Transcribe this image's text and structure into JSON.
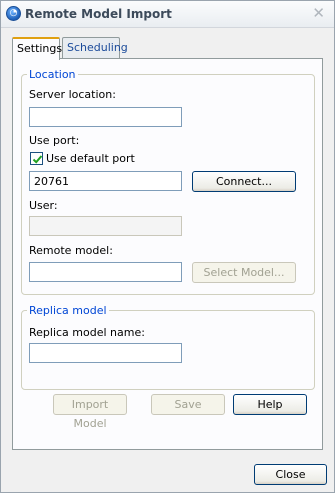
{
  "window": {
    "title": "Remote Model Import",
    "app_icon": "app-icon"
  },
  "tabs": [
    {
      "label": "Settings",
      "active": true
    },
    {
      "label": "Scheduling",
      "active": false
    }
  ],
  "location": {
    "legend": "Location",
    "server_location_label": "Server location:",
    "server_location_value": "",
    "use_port_label": "Use port:",
    "use_default_port_label": "Use default port",
    "use_default_port_checked": true,
    "port_value": "20761",
    "connect_label": "Connect...",
    "user_label": "User:",
    "user_value": "",
    "remote_model_label": "Remote model:",
    "remote_model_value": "",
    "select_model_label": "Select Model..."
  },
  "replica": {
    "legend": "Replica model",
    "replica_name_label": "Replica model name:",
    "replica_name_value": ""
  },
  "actions": {
    "import_model_label": "Import Model",
    "save_label": "Save",
    "help_label": "Help"
  },
  "footer": {
    "close_label": "Close"
  },
  "colors": {
    "accent": "#0046d5",
    "tab_highlight": "#e0a010",
    "check": "#21a121"
  }
}
